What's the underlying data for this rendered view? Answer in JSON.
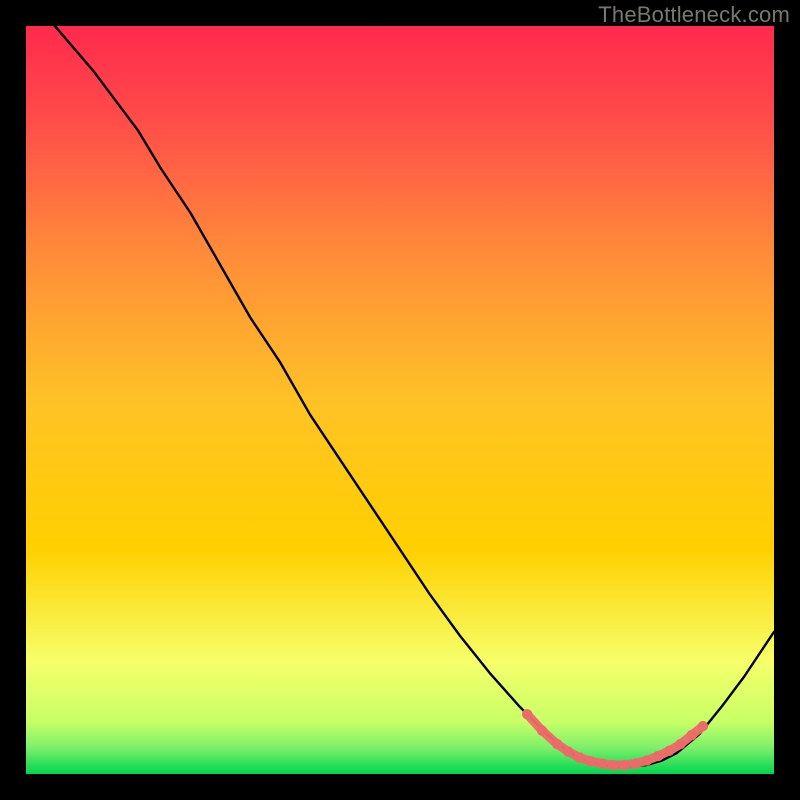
{
  "watermark": "TheBottleneck.com",
  "colors": {
    "bg": "#000000",
    "gradient_top": "#ff2a4d",
    "gradient_mid": "#ffd000",
    "gradient_low": "#f6ff6a",
    "gradient_bottom": "#00d64f",
    "curve": "#000000",
    "marker": "#ee6a6a"
  },
  "chart_data": {
    "type": "line",
    "title": "",
    "xlabel": "",
    "ylabel": "",
    "xlim": [
      0,
      100
    ],
    "ylim": [
      0,
      100
    ],
    "series": [
      {
        "name": "bottleneck-curve",
        "x": [
          0,
          3,
          6,
          9,
          12,
          15,
          18,
          22,
          26,
          30,
          34,
          38,
          42,
          46,
          50,
          54,
          58,
          62,
          66,
          70,
          73,
          75,
          77,
          79,
          81,
          83,
          85,
          87,
          90,
          93,
          96,
          100
        ],
        "y": [
          105,
          101,
          97.5,
          94,
          90,
          86,
          81,
          75,
          68,
          61,
          55,
          48,
          42,
          36,
          30,
          24,
          18.5,
          13.5,
          9,
          5,
          2.6,
          1.8,
          1.2,
          1.0,
          1.0,
          1.2,
          1.8,
          2.8,
          5.3,
          9,
          13,
          19
        ]
      },
      {
        "name": "optimal-markers",
        "x": [
          67,
          69,
          71,
          72.5,
          74,
          75.5,
          77,
          78.5,
          80,
          81.5,
          83,
          84.5,
          86,
          87.5,
          89,
          90.5
        ],
        "y": [
          8.0,
          5.8,
          4.0,
          3.0,
          2.2,
          1.7,
          1.4,
          1.2,
          1.2,
          1.4,
          1.8,
          2.4,
          3.1,
          4.0,
          5.2,
          6.4
        ]
      }
    ]
  }
}
